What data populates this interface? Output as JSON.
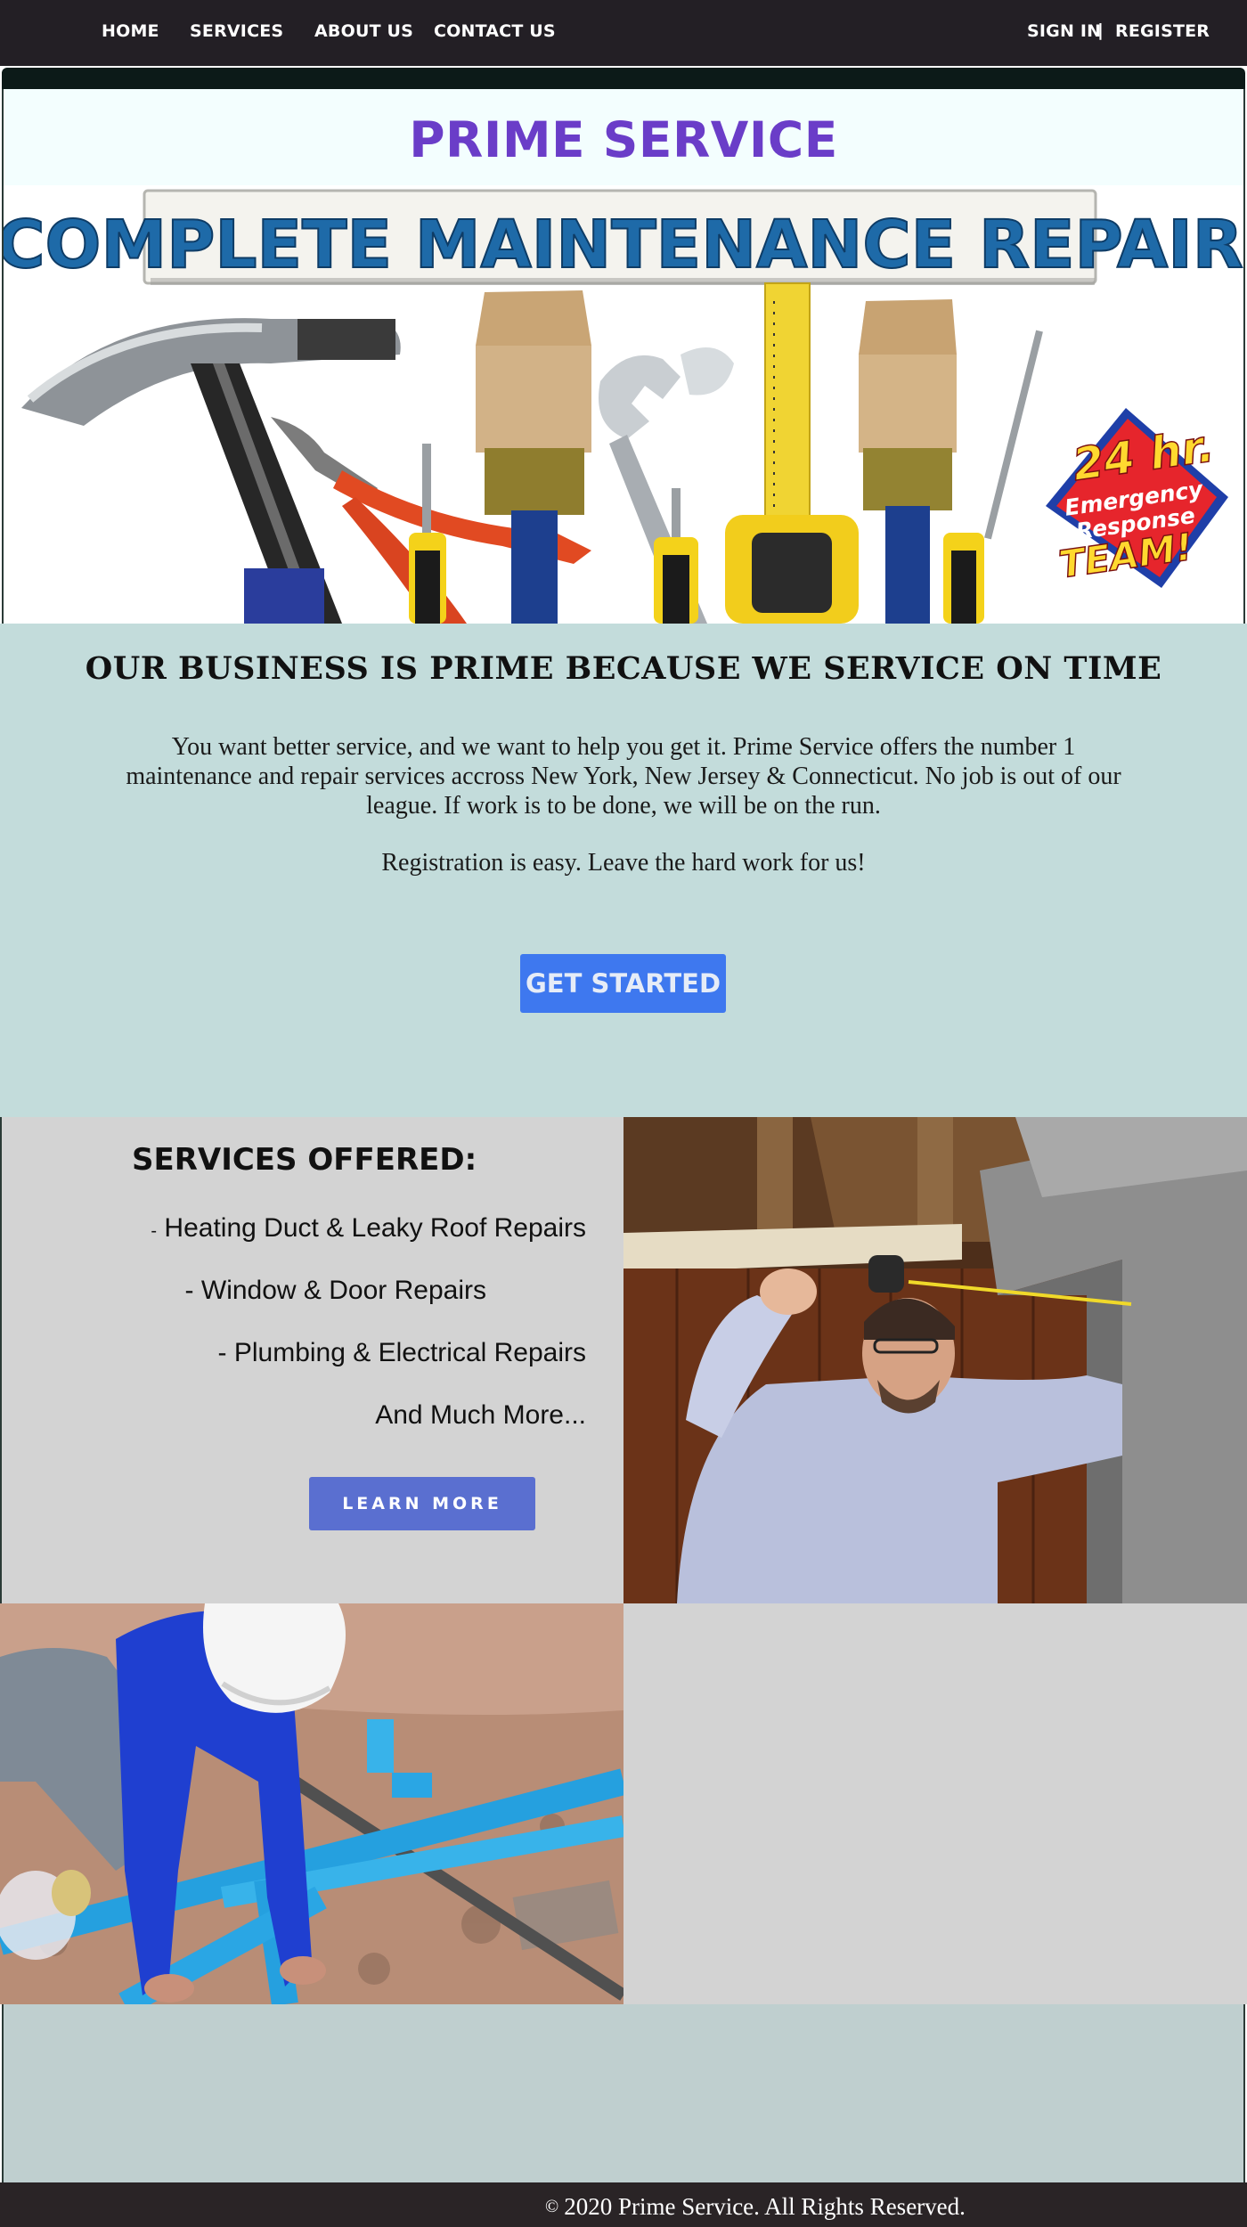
{
  "nav": {
    "left": [
      {
        "label": "HOME"
      },
      {
        "label": "SERVICES"
      },
      {
        "label": "ABOUT US"
      },
      {
        "label": "CONTACT US"
      }
    ],
    "sign_in": "SIGN IN",
    "separator": "|",
    "register": "REGISTER"
  },
  "brand": {
    "title": "PRIME SERVICE",
    "color": "#6a3dc8"
  },
  "hero": {
    "banner_text": "COMPLETE MAINTENANCE REPAIR",
    "badge_lines": [
      "24 hr.",
      "Emergency",
      "Response",
      "TEAM!"
    ]
  },
  "intro": {
    "heading": "OUR BUSINESS IS PRIME BECAUSE WE SERVICE ON TIME",
    "body": "You want better service, and we want to help you get it. Prime Service offers the number 1 maintenance and repair services accross New York, New Jersey & Connecticut. No job is out of our league. If work is to be done, we will be on the run.",
    "sub": "Registration is easy. Leave the hard work for us!",
    "cta": "GET STARTED",
    "cta_color": "#3e78ef"
  },
  "services": {
    "heading": "SERVICES OFFERED:",
    "items": [
      {
        "dash": "-",
        "text": " Heating Duct & Leaky Roof Repairs"
      },
      {
        "dash": "- ",
        "text": "Window & Door Repairs"
      },
      {
        "dash": "- ",
        "text": "Plumbing & Electrical Repairs"
      },
      {
        "dash": "",
        "text": "And Much More..."
      }
    ],
    "cta": "LEARN MORE",
    "cta_color": "#5a6fd0"
  },
  "footer": {
    "copyright_symbol": "©",
    "text": "2020 Prime Service. All Rights Reserved."
  }
}
